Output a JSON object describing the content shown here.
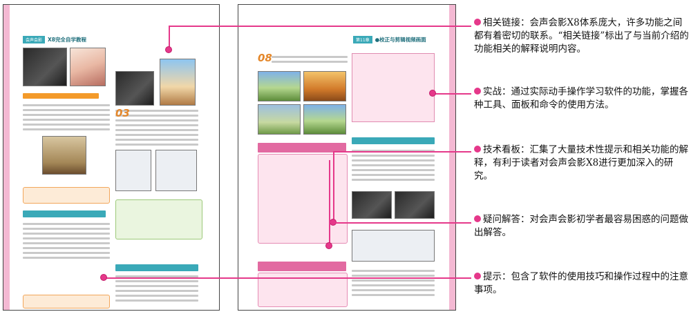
{
  "left_page": {
    "header_tag": "会声会影",
    "header_title": "X8完全自学教程"
  },
  "right_page": {
    "header_tag": "第11章",
    "header_title": "●校正与剪辑视频画面"
  },
  "annotations": [
    {
      "label": "相关链接",
      "text": "相关链接：会声会影X8体系庞大，许多功能之间都有着密切的联系。“相关链接”标出了与当前介绍的功能相关的解释说明内容。"
    },
    {
      "label": "实战",
      "text": "实战：通过实际动手操作学习软件的功能，掌握各种工具、面板和命令的使用方法。"
    },
    {
      "label": "技术看板",
      "text": "技术看板：汇集了大量技术性提示和相关功能的解释，有利于读者对会声会影X8进行更加深入的研究。"
    },
    {
      "label": "疑问解答",
      "text": "疑问解答：对会声会影初学者最容易困惑的问题做出解答。"
    },
    {
      "label": "提示",
      "text": "提示：包含了软件的使用技巧和操作过程中的注意事项。"
    }
  ],
  "colors": {
    "accent": "#e5388a",
    "teal": "#3aa9b8",
    "pink_stripe": "#f4b9d3"
  }
}
